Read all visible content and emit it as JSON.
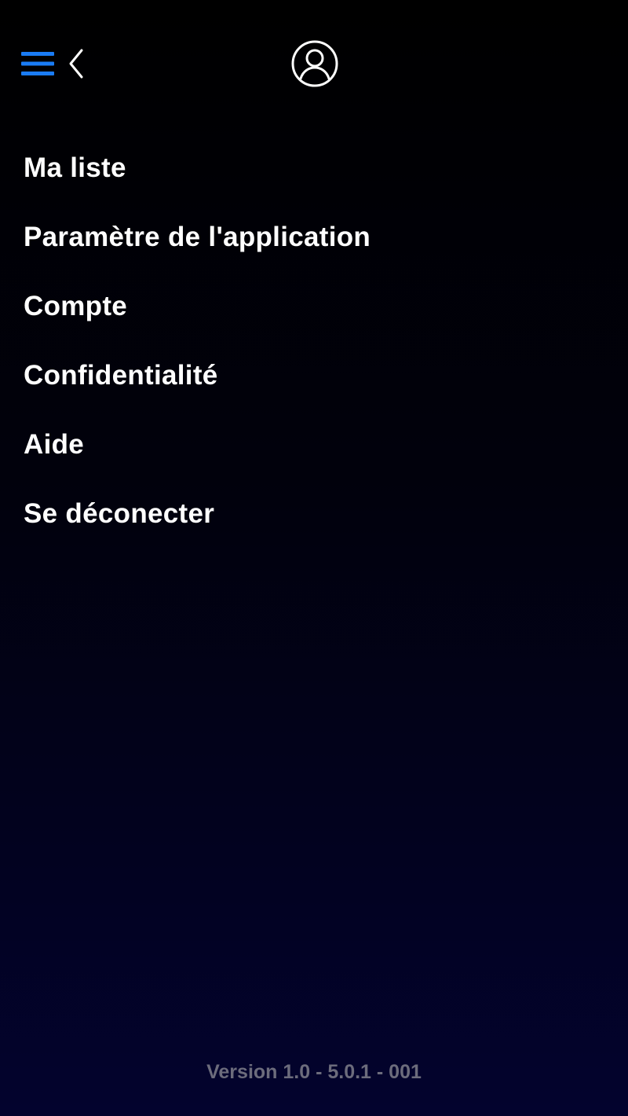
{
  "colors": {
    "accent": "#1a7cf5",
    "text": "#ffffff",
    "muted": "#6c6c7c"
  },
  "header": {
    "menu_icon": "hamburger-menu-icon",
    "back_icon": "chevron-left-icon",
    "profile_icon": "user-circle-icon"
  },
  "menu": {
    "items": [
      {
        "label": "Ma liste"
      },
      {
        "label": "Paramètre de l'application"
      },
      {
        "label": "Compte"
      },
      {
        "label": "Confidentialité"
      },
      {
        "label": "Aide"
      },
      {
        "label": "Se déconecter"
      }
    ]
  },
  "footer": {
    "version": "Version 1.0 - 5.0.1 - 001"
  }
}
